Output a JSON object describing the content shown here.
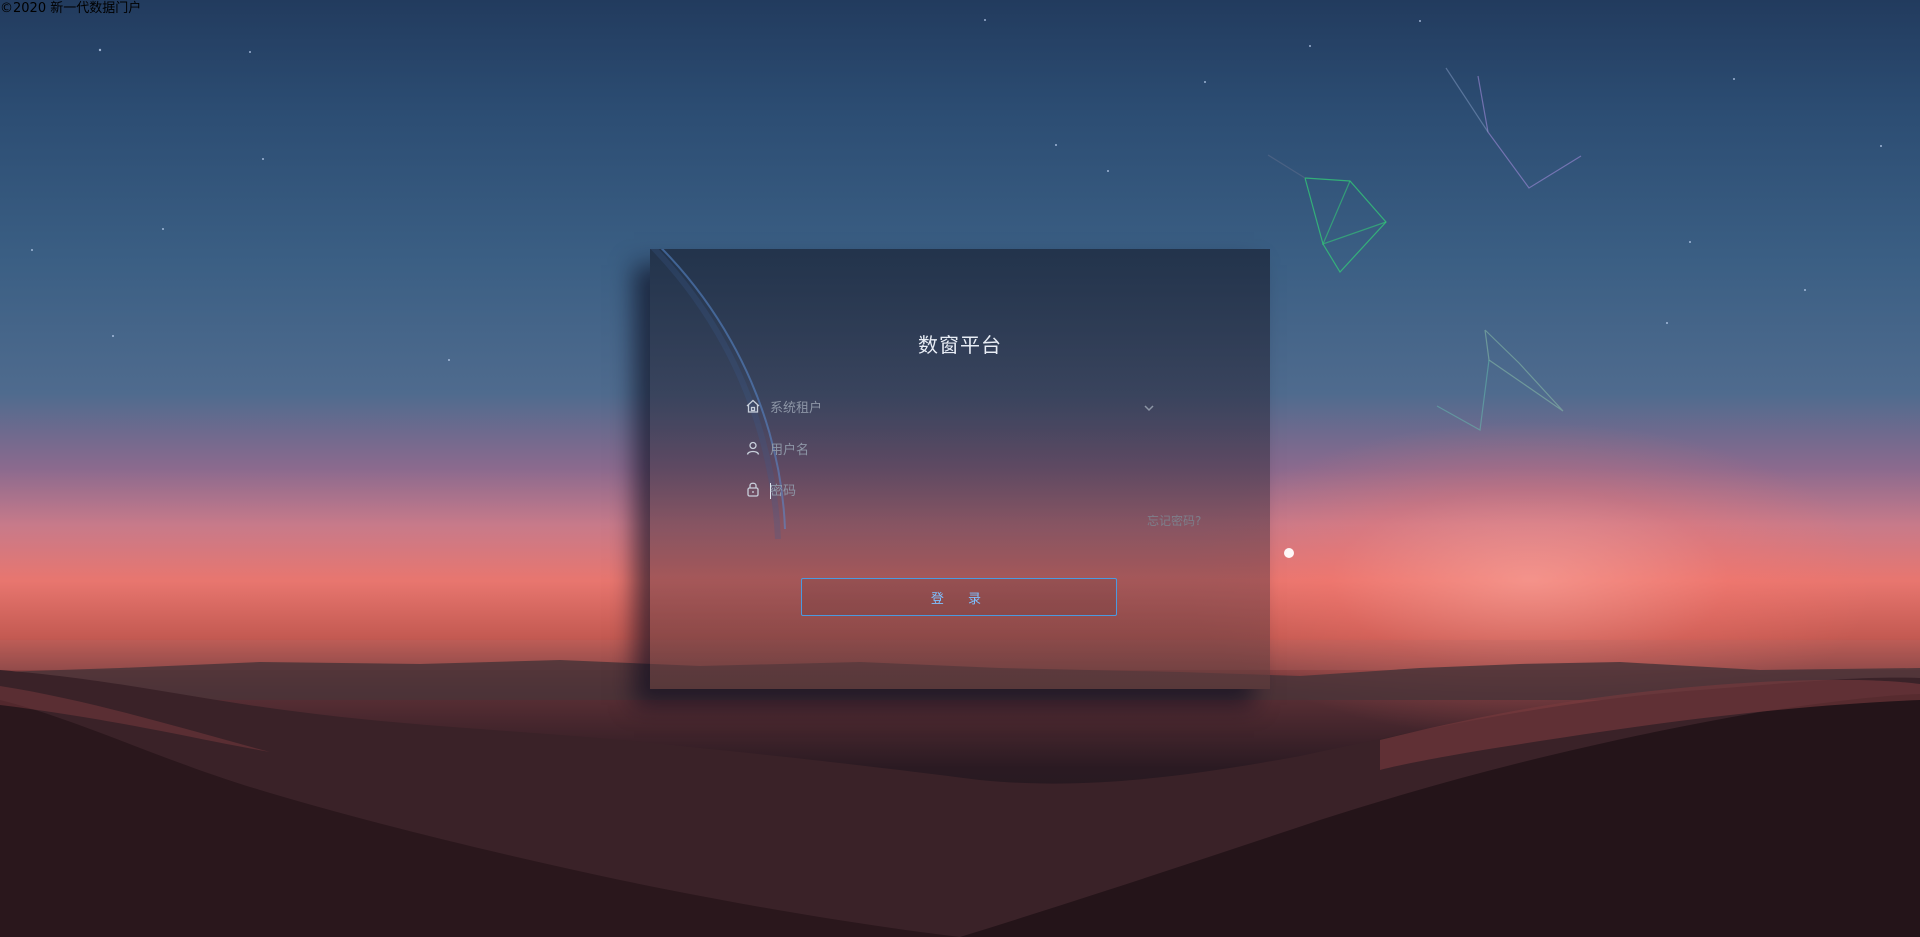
{
  "footer": {
    "copyright": "©2020 新一代数据门户"
  },
  "login": {
    "title": "数窗平台",
    "tenant_placeholder": "系统租户",
    "username_placeholder": "用户名",
    "password_placeholder": "密码",
    "forgot_password": "忘记密码?",
    "submit_label": "登 录"
  },
  "icons": {
    "tenant": "home-icon",
    "username": "user-icon",
    "password": "lock-icon",
    "dropdown": "chevron-down-icon"
  },
  "colors": {
    "accent": "#4a9ae0",
    "button_text": "#7ec0ff",
    "title": "#e8edf5"
  }
}
